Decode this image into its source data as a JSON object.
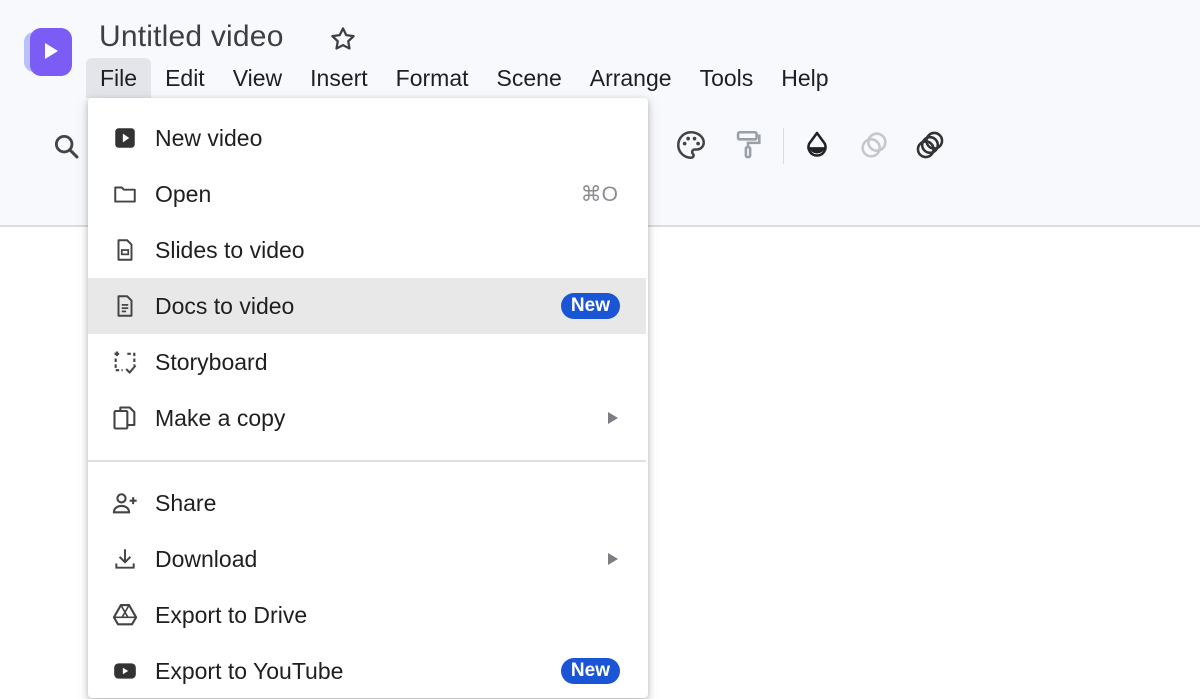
{
  "app": {
    "title": "Untitled video",
    "accent": "#7b5cf5"
  },
  "menubar": [
    "File",
    "Edit",
    "View",
    "Insert",
    "Format",
    "Scene",
    "Arrange",
    "Tools",
    "Help"
  ],
  "toolbar": {
    "icons": [
      "search-icon",
      "palette-icon",
      "paint-roller-icon",
      "fill-color-icon",
      "opacity-icon",
      "layers-icon"
    ]
  },
  "file_menu": {
    "items": [
      {
        "label": "New video",
        "icon": "new-video-icon"
      },
      {
        "label": "Open",
        "icon": "folder-icon",
        "shortcut": "⌘O"
      },
      {
        "label": "Slides to video",
        "icon": "slides-icon"
      },
      {
        "label": "Docs to video",
        "icon": "docs-icon",
        "badge": "New",
        "highlighted": true
      },
      {
        "label": "Storyboard",
        "icon": "storyboard-icon"
      },
      {
        "label": "Make a copy",
        "icon": "copy-icon",
        "submenu": true
      },
      {
        "label": "Share",
        "icon": "share-icon"
      },
      {
        "label": "Download",
        "icon": "download-icon",
        "submenu": true
      },
      {
        "label": "Export to Drive",
        "icon": "drive-icon"
      },
      {
        "label": "Export to YouTube",
        "icon": "youtube-icon",
        "badge": "New"
      }
    ]
  },
  "colors": {
    "badge": "#1a55d6",
    "highlight": "#e8e8e8",
    "topband": "#f8f9fd"
  }
}
